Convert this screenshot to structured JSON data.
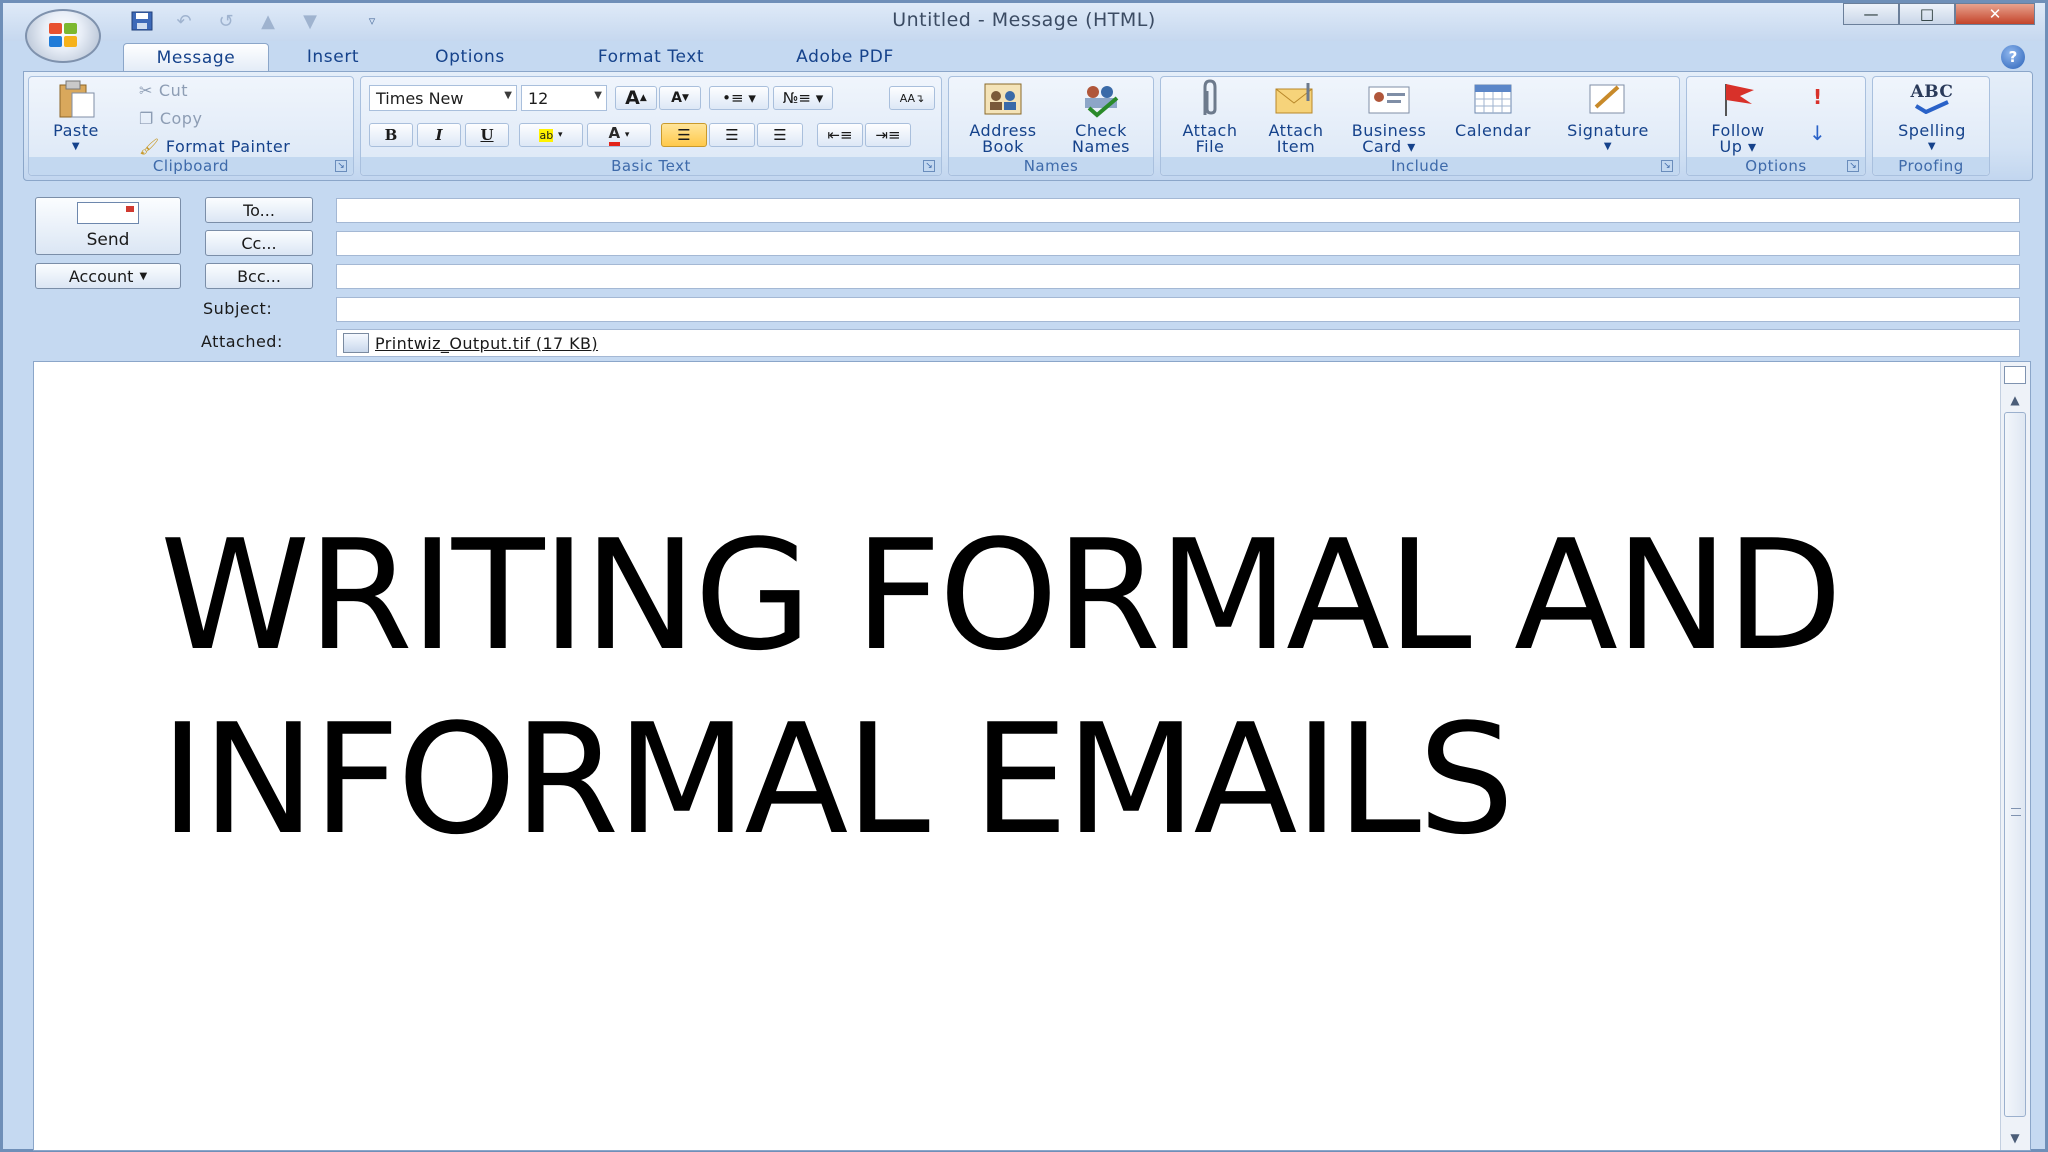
{
  "window": {
    "title": "Untitled - Message (HTML)",
    "controls": {
      "minimize": "—",
      "maximize": "□",
      "close": "✕"
    }
  },
  "qat_icons": [
    "save-icon",
    "undo-icon",
    "redo-icon",
    "previous-icon",
    "next-icon",
    "customize-icon"
  ],
  "tabs": [
    "Message",
    "Insert",
    "Options",
    "Format Text",
    "Adobe PDF"
  ],
  "ribbon": {
    "clipboard": {
      "label": "Clipboard",
      "paste": "Paste",
      "cut": "Cut",
      "copy": "Copy",
      "format_painter": "Format Painter"
    },
    "basic_text": {
      "label": "Basic Text",
      "font": "Times New",
      "size": "12",
      "bold": "B",
      "italic": "I",
      "underline": "U",
      "grow_font": "A",
      "shrink_font": "A"
    },
    "names": {
      "label": "Names",
      "address_book": [
        "Address",
        "Book"
      ],
      "check_names": [
        "Check",
        "Names"
      ]
    },
    "include": {
      "label": "Include",
      "attach_file": [
        "Attach",
        "File"
      ],
      "attach_item": [
        "Attach",
        "Item"
      ],
      "business_card": [
        "Business",
        "Card ▾"
      ],
      "calendar": "Calendar",
      "signature": "Signature"
    },
    "options": {
      "label": "Options",
      "follow_up": [
        "Follow",
        "Up ▾"
      ]
    },
    "proofing": {
      "label": "Proofing",
      "spelling": "Spelling",
      "abc": "ABC"
    }
  },
  "form": {
    "send": "Send",
    "account": "Account",
    "to": "To...",
    "cc": "Cc...",
    "bcc": "Bcc...",
    "subject_label": "Subject:",
    "attached_label": "Attached:",
    "attachment": "Printwiz_Output.tif (17 KB)",
    "to_value": "",
    "cc_value": "",
    "bcc_value": "",
    "subject_value": ""
  },
  "body": {
    "line1": "WRITING FORMAL AND",
    "line2": "INFORMAL EMAILS"
  },
  "colors": {
    "frame": "#c5d9f1",
    "ribbon_text": "#15428b",
    "group_label": "#3e6aaa"
  }
}
